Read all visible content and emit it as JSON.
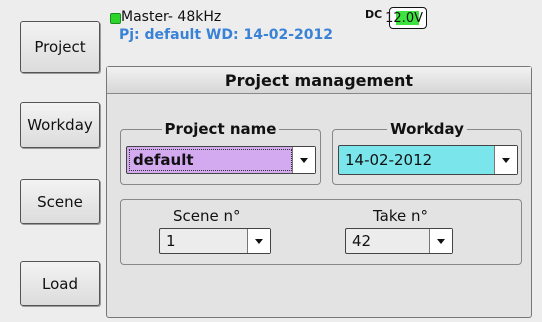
{
  "sidebar": {
    "project_label": "Project",
    "workday_label": "Workday",
    "scene_label": "Scene",
    "load_label": "Load"
  },
  "header": {
    "master": "Master- 48kHz",
    "dc_label": "DC",
    "dc_value_main": "12.0",
    "dc_unit": "V",
    "project_line": "Pj: default  WD: 14-02-2012",
    "status_color": "#2cd52c"
  },
  "panel": {
    "title": "Project management",
    "project": {
      "legend": "Project name",
      "value": "default",
      "color": "#d3a9f0"
    },
    "workday": {
      "legend": "Workday",
      "value": "14-02-2012",
      "color": "#7ae6ec"
    },
    "scene": {
      "label": "Scene n°",
      "value": "1"
    },
    "take": {
      "label": "Take n°",
      "value": "42"
    }
  }
}
